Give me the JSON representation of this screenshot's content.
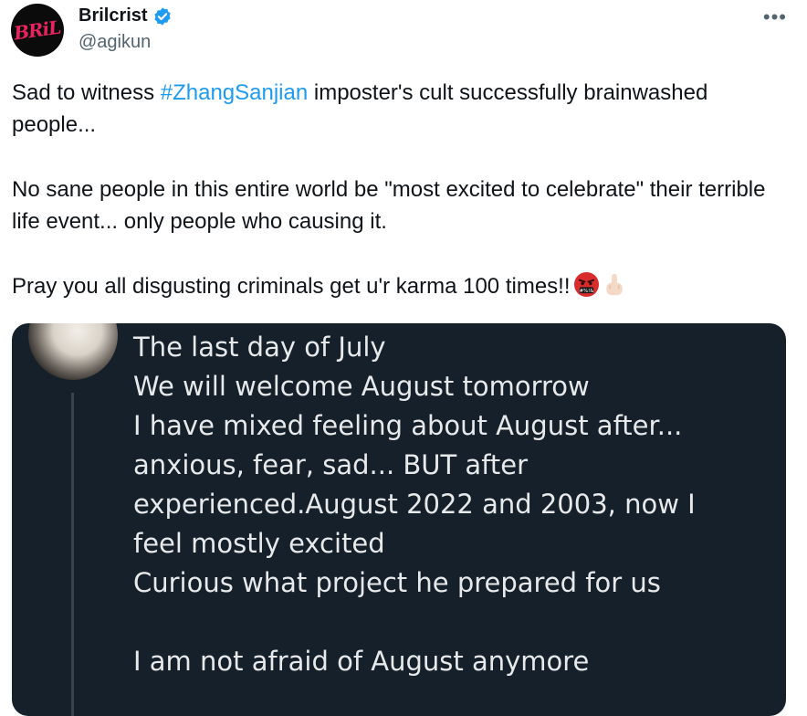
{
  "author": {
    "display_name": "Brilcrist",
    "handle": "@agikun",
    "avatar_text": "BRiL"
  },
  "tweet": {
    "line1_before": "Sad to witness ",
    "hashtag": "#ZhangSanjian",
    "line1_after": " imposter's cult successfully brainwashed people...",
    "para2": "No sane people in this entire world be \"most excited to celebrate\" their terrible life event... only people who causing it.",
    "para3": "Pray you all disgusting criminals get u'r karma 100 times!!"
  },
  "media": {
    "lines": [
      "The last day of July",
      "We will welcome August tomorrow",
      "I have mixed feeling about August after...",
      "anxious, fear, sad... BUT after",
      "experienced.August 2022 and 2003, now I",
      "feel mostly excited",
      "Curious what project he prepared for us",
      "",
      "I am not afraid of August anymore"
    ]
  },
  "icons": {
    "more": "more-icon",
    "verified": "verified-badge-icon",
    "emoji1": "cursing-face-emoji",
    "emoji2": "middle-finger-emoji"
  },
  "colors": {
    "hashtag": "#1d9bf0",
    "verified": "#1d9bf0",
    "media_bg": "#15202b",
    "media_text": "#e7e9ea"
  }
}
